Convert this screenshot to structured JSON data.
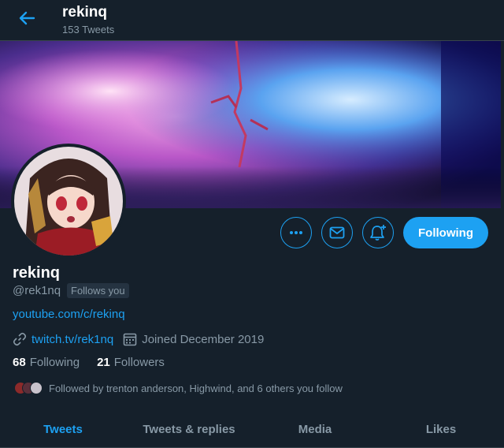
{
  "header": {
    "name": "rekinq",
    "tweet_count": "153 Tweets"
  },
  "profile": {
    "display_name": "rekinq",
    "handle": "@rek1nq",
    "follows_you": "Follows you",
    "bio_link": "youtube.com/c/rekinq",
    "website": "twitch.tv/rek1nq",
    "joined": "Joined December 2019",
    "following_count": "68",
    "following_label": "Following",
    "followers_count": "21",
    "followers_label": "Followers",
    "followed_by": "Followed by trenton anderson, Highwind, and 6 others you follow"
  },
  "actions": {
    "more_icon": "more-horizontal-icon",
    "message_icon": "envelope-icon",
    "notify_icon": "bell-plus-icon",
    "follow_label": "Following"
  },
  "tabs": [
    {
      "label": "Tweets",
      "active": true
    },
    {
      "label": "Tweets & replies",
      "active": false
    },
    {
      "label": "Media",
      "active": false
    },
    {
      "label": "Likes",
      "active": false
    }
  ],
  "colors": {
    "background": "#15202b",
    "accent": "#1da1f2",
    "secondary_text": "#8899a6",
    "border": "#38444d"
  }
}
